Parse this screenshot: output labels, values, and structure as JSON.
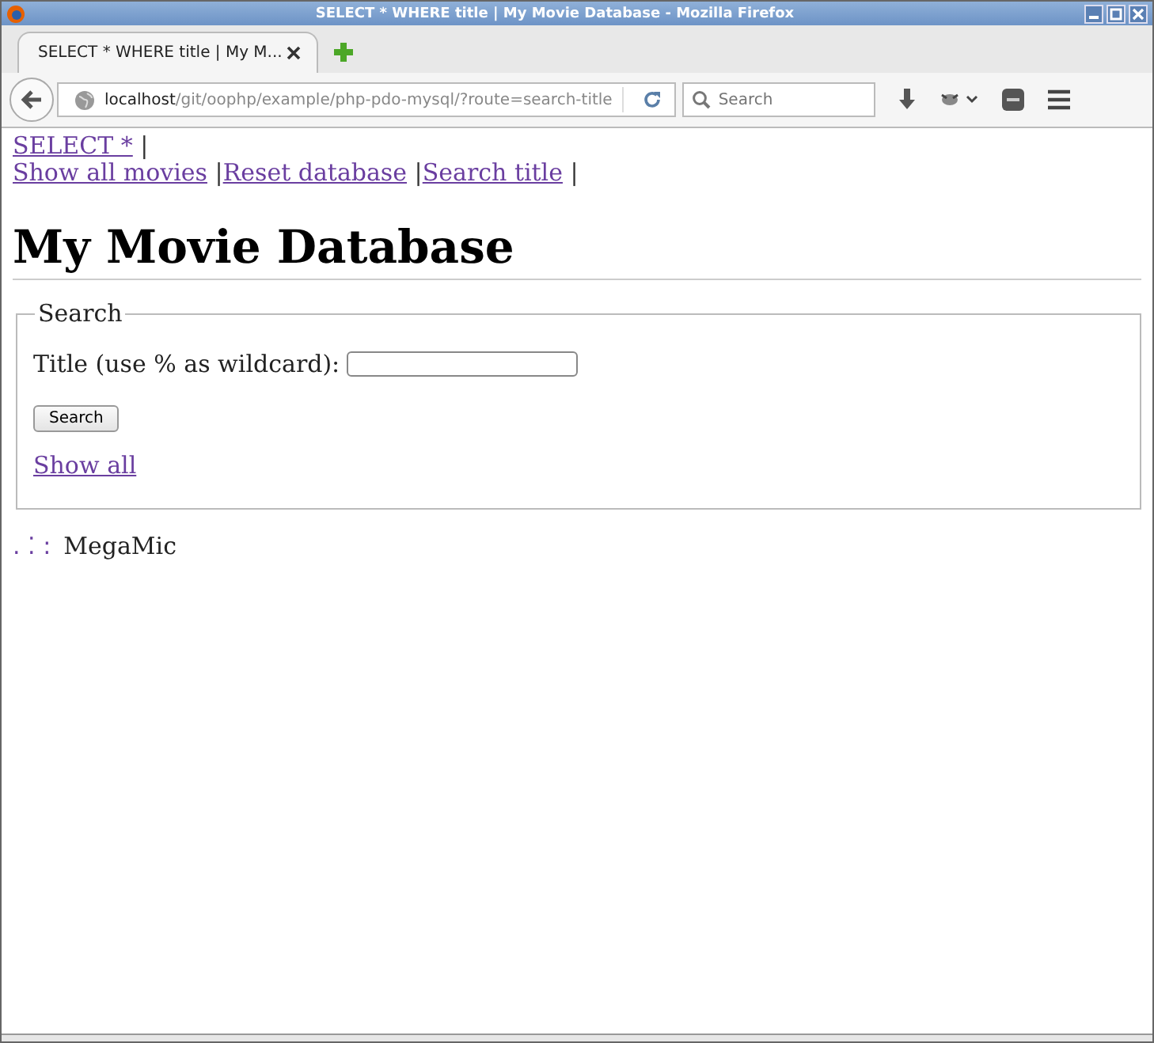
{
  "window": {
    "title": "SELECT * WHERE title | My Movie Database - Mozilla Firefox"
  },
  "tabs": [
    {
      "label": "SELECT * WHERE title | My M...",
      "selected": true
    }
  ],
  "url": {
    "host": "localhost",
    "path": "/git/oophp/example/php-pdo-mysql/?route=search-title"
  },
  "search": {
    "placeholder": "Search"
  },
  "nav": {
    "rows": [
      [
        {
          "label": "SELECT *"
        }
      ],
      [
        {
          "label": "Show all movies"
        },
        {
          "label": "Reset database"
        },
        {
          "label": "Search title"
        }
      ]
    ],
    "separator": "|"
  },
  "heading": "My Movie Database",
  "form": {
    "legend": "Search",
    "field_label": "Title (use % as wildcard):",
    "button": "Search",
    "link": "Show all"
  },
  "footer": {
    "mark": ". ⁚ :",
    "text": "MegaMic"
  }
}
